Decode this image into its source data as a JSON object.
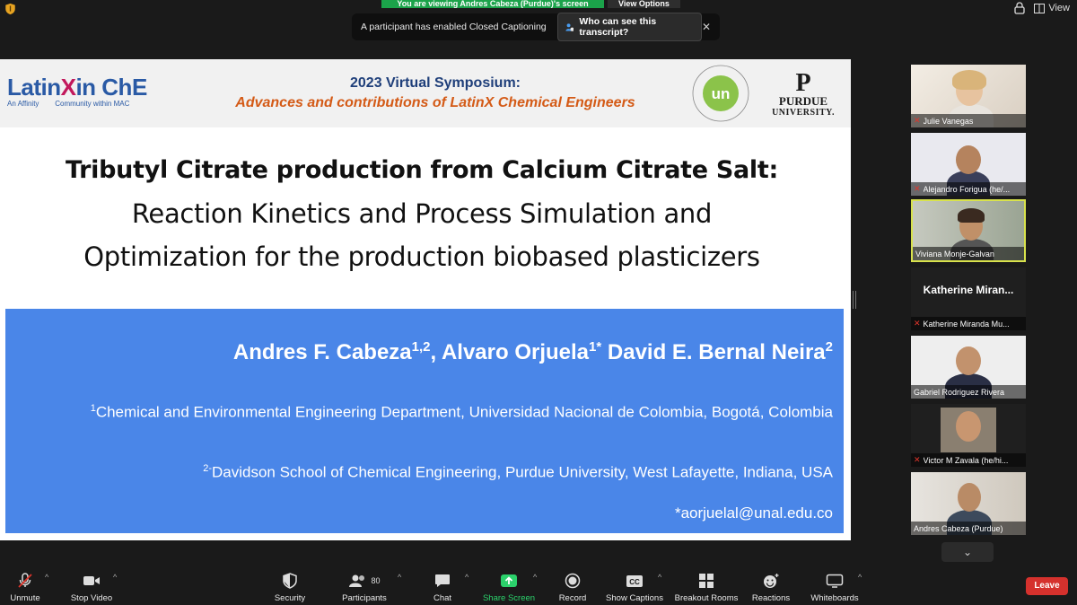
{
  "banner": {
    "viewing": "You are viewing Andres Cabeza (Purdue)'s screen",
    "view_options": "View Options",
    "view_label": "View"
  },
  "cc_notice": {
    "text": "A participant has enabled Closed Captioning",
    "who_button": "Who can see this transcript?",
    "close": "✕"
  },
  "slide": {
    "logo_main_a": "Latin",
    "logo_main_x": "X",
    "logo_main_b": "in ChE",
    "logo_sub": "An Affinity        Community within MAC",
    "symposium_title": "2023 Virtual Symposium:",
    "symposium_subtitle": "Advances and contributions of LatinX Chemical Engineers",
    "un_text": "un",
    "purdue_p": "P",
    "purdue_name": "PURDUE",
    "purdue_uni": "UNIVERSITY.",
    "title_line1": "Tributyl Citrate production from Calcium Citrate Salt:",
    "title_line2": "Reaction Kinetics and Process Simulation and",
    "title_line3": "Optimization for the production biobased plasticizers",
    "author1": "Andres F. Cabeza",
    "author1_sup": "1,2",
    "author2": ", Alvaro Orjuela",
    "author2_sup": "1*",
    "author3": " David E. Bernal Neira",
    "author3_sup": "2",
    "aff1_sup": "1",
    "aff1_text": "Chemical and Environmental Engineering Department, Universidad Nacional de Colombia, Bogotá, Colombia",
    "aff2_sup": "2-",
    "aff2_text": "Davidson School of Chemical Engineering, Purdue University, West Lafayette, Indiana, USA",
    "email": "*aorjuelal@unal.edu.co"
  },
  "participants": [
    {
      "name": "Julie Vanegas",
      "muted": true
    },
    {
      "name": "Alejandro Forigua (he/...",
      "muted": true
    },
    {
      "name": "Viviana Monje-Galvan",
      "muted": false,
      "active": true
    },
    {
      "name": "Katherine Miranda Mu...",
      "muted": true,
      "big_name": "Katherine  Miran..."
    },
    {
      "name": "Gabriel Rodriguez Rivera",
      "muted": false
    },
    {
      "name": "Victor M Zavala (he/hi...",
      "muted": true
    },
    {
      "name": "Andres Cabeza (Purdue)",
      "muted": false
    }
  ],
  "toolbar": {
    "unmute": "Unmute",
    "stop_video": "Stop Video",
    "security": "Security",
    "participants": "Participants",
    "participants_count": "80",
    "chat": "Chat",
    "share_screen": "Share Screen",
    "record": "Record",
    "show_captions": "Show Captions",
    "breakout_rooms": "Breakout Rooms",
    "reactions": "Reactions",
    "whiteboards": "Whiteboards",
    "leave": "Leave"
  },
  "colors": {
    "share_green": "#2bd16b",
    "leave_red": "#d5312d",
    "author_box": "#4a86e8",
    "banner_green": "#1ba34a"
  }
}
